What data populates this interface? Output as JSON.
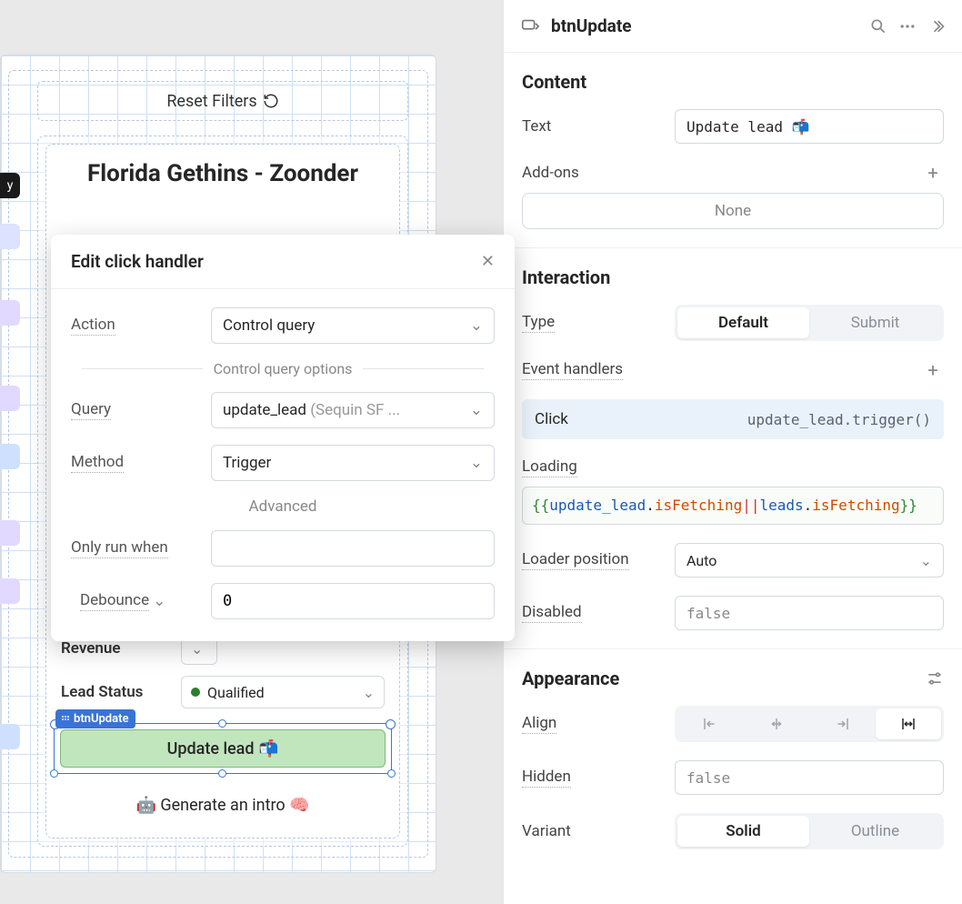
{
  "canvas": {
    "reset_label": "Reset Filters",
    "card_title": "Florida Gethins - Zoonder",
    "revenue_label": "Revenue",
    "lead_status_label": "Lead Status",
    "lead_status_value": "Qualified",
    "btn_badge": "btnUpdate",
    "update_label": "Update lead 📬",
    "generate_label": "🤖 Generate an intro 🧠"
  },
  "modal": {
    "title": "Edit click handler",
    "action_label": "Action",
    "action_value": "Control query",
    "divider_label": "Control query options",
    "query_label": "Query",
    "query_value": "update_lead",
    "query_src": "(Sequin SF ...",
    "method_label": "Method",
    "method_value": "Trigger",
    "advanced_label": "Advanced",
    "only_run_label": "Only run when",
    "debounce_label": "Debounce",
    "debounce_value": "0"
  },
  "inspector": {
    "component_name": "btnUpdate",
    "content": {
      "heading": "Content",
      "text_label": "Text",
      "text_value": "Update lead 📬",
      "addons_label": "Add-ons",
      "addons_none": "None"
    },
    "interaction": {
      "heading": "Interaction",
      "type_label": "Type",
      "type_options": [
        "Default",
        "Submit"
      ],
      "type_selected": "Default",
      "event_handlers_label": "Event handlers",
      "event_name": "Click",
      "event_code": "update_lead.trigger()",
      "loading_label": "Loading",
      "loading_expr_raw": "{{update_lead.isFetching||leads.isFetching}}",
      "loading_tokens": {
        "open": "{{",
        "id1": "update_lead",
        "dot1": ".",
        "prop1": "isFetching",
        "or": "||",
        "id2": "leads",
        "dot2": ".",
        "prop2": "isFetching",
        "close": "}}"
      },
      "loader_pos_label": "Loader position",
      "loader_pos_value": "Auto",
      "disabled_label": "Disabled",
      "disabled_value": "false"
    },
    "appearance": {
      "heading": "Appearance",
      "align_label": "Align",
      "hidden_label": "Hidden",
      "hidden_value": "false",
      "variant_label": "Variant",
      "variant_options": [
        "Solid",
        "Outline"
      ],
      "variant_selected": "Solid"
    }
  }
}
